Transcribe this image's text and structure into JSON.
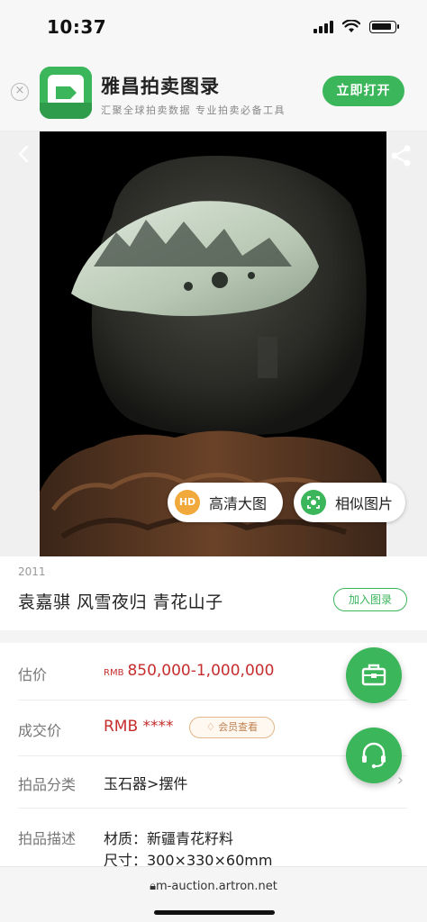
{
  "status_bar": {
    "time": "10:37"
  },
  "app_banner": {
    "title": "雅昌拍卖图录",
    "subtitle": "汇聚全球拍卖数据 专业拍卖必备工具",
    "open_label": "立即打开"
  },
  "image_actions": {
    "hd_badge": "HD",
    "hd_label": "高清大图",
    "similar_label": "相似图片"
  },
  "lot": {
    "year": "2011",
    "title": "袁嘉骐 风雪夜归 青花山子",
    "add_label": "加入图录"
  },
  "details": {
    "estimate_label": "估价",
    "estimate_currency": "RMB",
    "estimate_value": "850,000-1,000,000",
    "deal_label": "成交价",
    "deal_value": "RMB ****",
    "member_label": "会员查看",
    "category_label": "拍品分类",
    "category_value": "玉石器>摆件",
    "desc_label": "拍品描述",
    "material": "材质：新疆青花籽料",
    "size": "尺寸：300×330×60mm"
  },
  "url_bar": {
    "url": "m-auction.artron.net"
  },
  "colors": {
    "accent": "#3bb65a",
    "price": "#c62d2d",
    "hd": "#f2a93b"
  }
}
